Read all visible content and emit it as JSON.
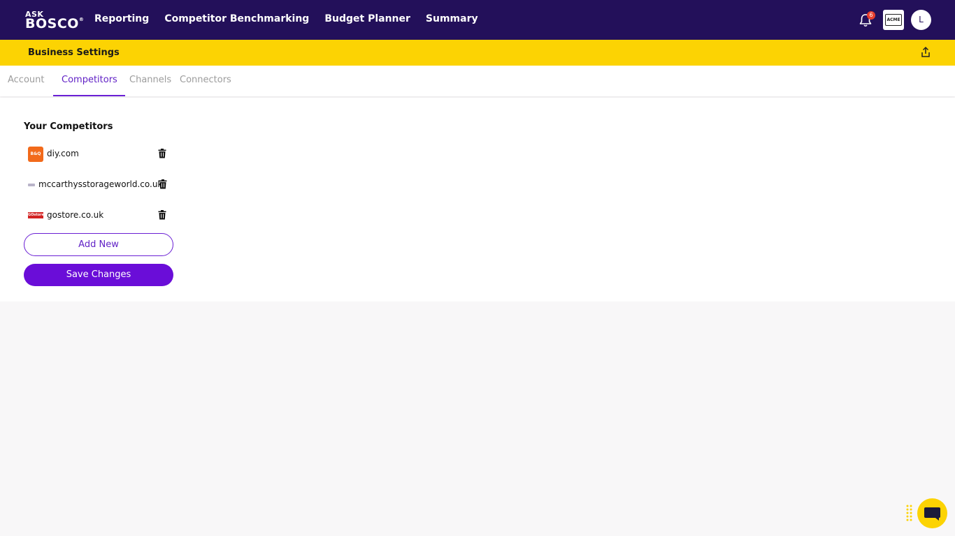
{
  "header": {
    "logo_top": "ASK",
    "logo_bottom": "BOSCO",
    "logo_reg": "®",
    "nav": [
      "Reporting",
      "Competitor Benchmarking",
      "Budget Planner",
      "Summary"
    ],
    "notification_count": "6",
    "company_logo_text": "ACME",
    "avatar_initial": "L"
  },
  "settings_bar": {
    "title": "Business Settings"
  },
  "tabs": {
    "items": [
      "Account",
      "Competitors",
      "Channels",
      "Connectors"
    ],
    "active": "Competitors"
  },
  "competitors": {
    "title": "Your Competitors",
    "items": [
      {
        "domain": "diy.com",
        "favicon_text": "B&Q",
        "favicon_color": "#f26a1b"
      },
      {
        "domain": "mccarthysstorageworld.co.uk",
        "favicon_color": "#b9b4c9"
      },
      {
        "domain": "gostore.co.uk",
        "favicon_text": "GOstore",
        "favicon_color": "#d22222"
      }
    ],
    "add_label": "Add New",
    "save_label": "Save Changes"
  },
  "colors": {
    "nav_bg": "#23105a",
    "accent_yellow": "#fcd303",
    "accent_purple": "#6a0dd8"
  },
  "icons": [
    "bell-icon",
    "share-icon",
    "trash-icon",
    "chat-icon",
    "grip-icon"
  ]
}
